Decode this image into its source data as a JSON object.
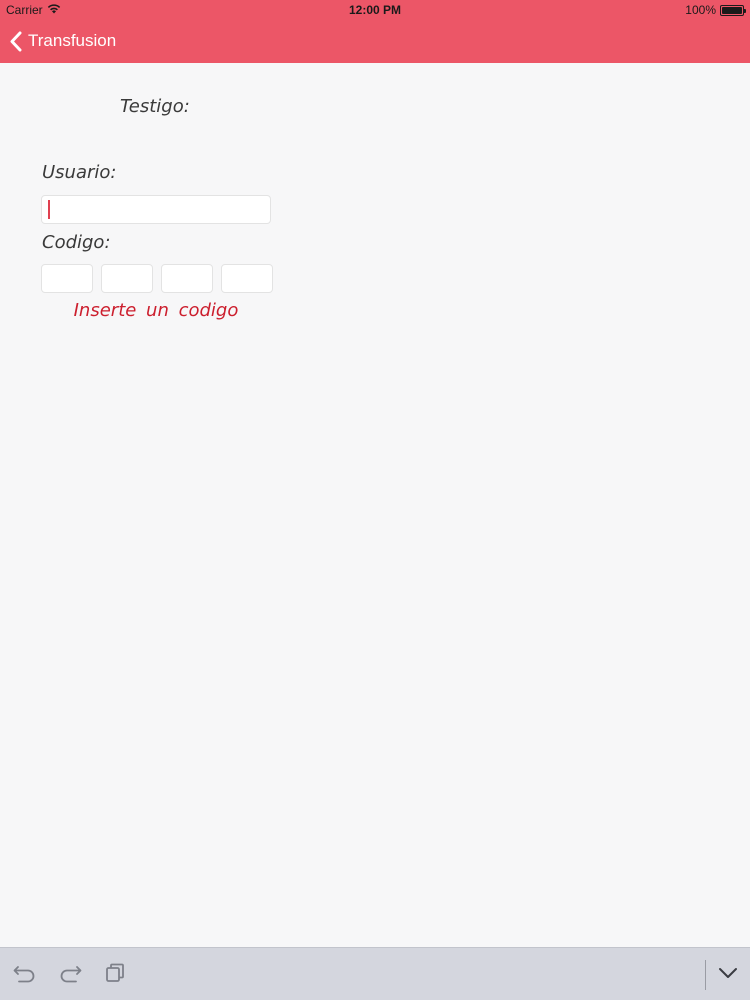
{
  "status_bar": {
    "carrier": "Carrier",
    "time": "12:00 PM",
    "battery_percent": "100%",
    "icons": [
      "wifi-icon",
      "battery-icon"
    ]
  },
  "nav": {
    "back_label": "Transfusion",
    "back_icon": "chevron-left-icon"
  },
  "form": {
    "witness_label": "Testigo:",
    "user_label": "Usuario:",
    "user_value": "",
    "code_label": "Codigo:",
    "code_digits": [
      "",
      "",
      "",
      ""
    ],
    "error_message": "Inserte un codigo"
  },
  "toolbar": {
    "icons": [
      "undo-icon",
      "redo-icon",
      "paste-icon",
      "chevron-down-icon"
    ]
  },
  "colors": {
    "accent": "#ec5667",
    "error": "#cc1f2e",
    "background": "#f7f7f8",
    "toolbar": "#d4d6de"
  }
}
